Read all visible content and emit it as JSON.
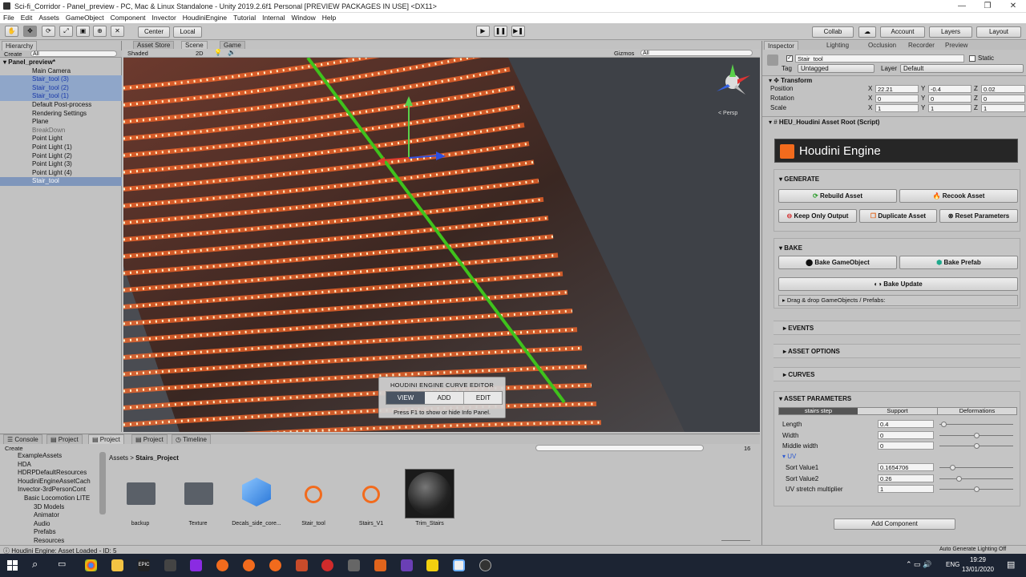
{
  "window": {
    "title": "Sci-fi_Corridor - Panel_preview - PC, Mac & Linux Standalone - Unity 2019.2.6f1 Personal [PREVIEW PACKAGES IN USE] <DX11>"
  },
  "menu": [
    "File",
    "Edit",
    "Assets",
    "GameObject",
    "Component",
    "Invector",
    "HoudiniEngine",
    "Tutorial",
    "Internal",
    "Window",
    "Help"
  ],
  "toolbar": {
    "center": "Center",
    "local": "Local",
    "collab": "Collab",
    "account": "Account",
    "layers": "Layers",
    "layout": "Layout"
  },
  "hierarchy": {
    "tab": "Hierarchy",
    "create": "Create",
    "search": "All",
    "scene": "Panel_preview*",
    "items": [
      "Main Camera",
      "Stair_tool (3)",
      "Stair_tool (2)",
      "Stair_tool (1)",
      "Default Post-process",
      "Rendering Settings",
      "Plane",
      "BreakDown",
      "Point Light",
      "Point Light (1)",
      "Point Light (2)",
      "Point Light (3)",
      "Point Light (4)",
      "Stair_tool"
    ]
  },
  "scene_tabs": {
    "asset_store": "Asset Store",
    "scene": "Scene",
    "game": "Game",
    "shaded": "Shaded",
    "mode_2d": "2D",
    "gizmos": "Gizmos",
    "search": "All",
    "persp": "< Persp"
  },
  "curve_editor": {
    "title": "HOUDINI ENGINE CURVE EDITOR",
    "view": "VIEW",
    "add": "ADD",
    "edit": "EDIT",
    "hint": "Press F1 to show or hide Info Panel."
  },
  "project": {
    "tabs": [
      "Console",
      "Project",
      "Project",
      "Project",
      "Timeline"
    ],
    "create": "Create",
    "breadcrumb_root": "Assets",
    "breadcrumb_child": "Stairs_Project",
    "count": "16",
    "tree": [
      "ExampleAssets",
      "HDA",
      "HDRPDefaultResources",
      "HoudiniEngineAssetCach",
      "Invector-3rdPersonCont",
      "Basic Locomotion LITE",
      "3D Models",
      "Animator",
      "Audio",
      "Prefabs",
      "Resources"
    ],
    "assets": [
      "backup",
      "Texture",
      "Decals_side_core...",
      "Stair_tool",
      "Stairs_V1",
      "Trim_Stairs"
    ]
  },
  "inspector": {
    "tabs": [
      "Inspector",
      "Lighting",
      "Occlusion",
      "Recorder",
      "Preview"
    ],
    "object": "Stair_tool",
    "static": "Static",
    "tag_label": "Tag",
    "tag": "Untagged",
    "layer_label": "Layer",
    "layer": "Default",
    "transform": {
      "title": "Transform",
      "rows": [
        {
          "label": "Position",
          "x": "22.21",
          "y": "-0.4",
          "z": "0.02"
        },
        {
          "label": "Rotation",
          "x": "0",
          "y": "0",
          "z": "0"
        },
        {
          "label": "Scale",
          "x": "1",
          "y": "1",
          "z": "1"
        }
      ]
    },
    "script": "HEU_Houdini Asset Root (Script)",
    "banner": "Houdini Engine",
    "generate": {
      "title": "GENERATE",
      "rebuild": "Rebuild Asset",
      "recook": "Recook Asset",
      "keep": "Keep Only Output",
      "duplicate": "Duplicate Asset",
      "reset": "Reset Parameters"
    },
    "bake": {
      "title": "BAKE",
      "gameobject": "Bake GameObject",
      "prefab": "Bake Prefab",
      "update": "Bake Update",
      "drag": "Drag & drop GameObjects / Prefabs:"
    },
    "events": "EVENTS",
    "asset_options": "ASSET OPTIONS",
    "curves": "CURVES",
    "asset_params": "ASSET PARAMETERS",
    "param_tabs": [
      "stairs step",
      "Support",
      "Deformations"
    ],
    "params": [
      {
        "label": "Length",
        "value": "0.4",
        "level": 0.05
      },
      {
        "label": "Width",
        "value": "0",
        "level": 0.5
      },
      {
        "label": "Middle width",
        "value": "0",
        "level": 0.5
      }
    ],
    "uv": {
      "title": "UV",
      "params": [
        {
          "label": "Sort Value1",
          "value": "0.1654706",
          "level": 0.17
        },
        {
          "label": "Sort Value2",
          "value": "0.26",
          "level": 0.26
        },
        {
          "label": "UV stretch multiplier",
          "value": "1",
          "level": 0.5
        }
      ]
    },
    "add_component": "Add Component"
  },
  "status": {
    "message": "Houdini Engine: Asset Loaded - ID: 5",
    "right": "Auto Generate Lighting Off"
  },
  "taskbar": {
    "lang": "ENG",
    "time": "19:29",
    "date": "13/01/2020"
  }
}
